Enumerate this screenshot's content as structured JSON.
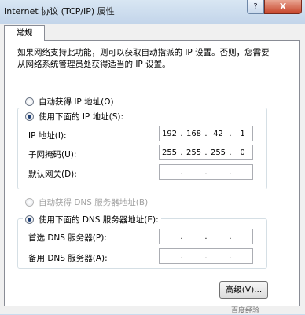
{
  "window": {
    "title": "Internet 协议 (TCP/IP) 属性",
    "help_button": "?",
    "close_button": "X"
  },
  "tabs": [
    {
      "label": "常规",
      "selected": true
    }
  ],
  "description": "如果网络支持此功能，则可以获取自动指派的 IP 设置。否则，您需要从网络系统管理员处获得适当的 IP 设置。",
  "ip_mode": {
    "auto_label": "自动获得 IP 地址(O)",
    "manual_label": "使用下面的 IP 地址(S):",
    "selected": "manual"
  },
  "ip_fields": {
    "ip_label": "IP 地址(I):",
    "ip_value": [
      "192",
      "168",
      "42",
      "1"
    ],
    "mask_label": "子网掩码(U):",
    "mask_value": [
      "255",
      "255",
      "255",
      "0"
    ],
    "gateway_label": "默认网关(D):",
    "gateway_value": [
      "",
      "",
      "",
      ""
    ]
  },
  "dns_mode": {
    "auto_label": "自动获得 DNS 服务器地址(B)",
    "auto_enabled": false,
    "manual_label": "使用下面的 DNS 服务器地址(E):",
    "selected": "manual"
  },
  "dns_fields": {
    "preferred_label": "首选 DNS 服务器(P):",
    "preferred_value": [
      "",
      "",
      "",
      ""
    ],
    "alternate_label": "备用 DNS 服务器(A):",
    "alternate_value": [
      "",
      "",
      "",
      ""
    ]
  },
  "advanced_button": "高级(V)...",
  "watermark": "百度经验"
}
